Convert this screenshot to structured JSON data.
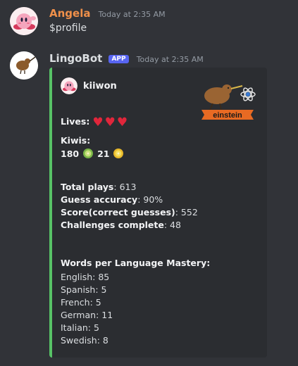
{
  "messages": [
    {
      "username": "Angela",
      "username_color": "#f0904a",
      "timestamp": "Today at 2:35 AM",
      "text": "$profile"
    },
    {
      "username": "LingoBot",
      "username_color": "#f2f3f5",
      "badge": "APP",
      "timestamp": "Today at 2:35 AM"
    }
  ],
  "embed": {
    "accent_color": "#57c266",
    "author": "kiiwon",
    "thumbnail_banner": "einstein",
    "lives_label": "Lives",
    "lives_count": 3,
    "kiwis_label": "Kiwis:",
    "kiwis_green": "180",
    "kiwis_gold": "21",
    "stats": [
      {
        "label": "Total plays",
        "value": "613"
      },
      {
        "label": "Guess accuracy",
        "value": "90%"
      },
      {
        "label": "Score(correct guesses)",
        "value": "552"
      },
      {
        "label": "Challenges complete",
        "value": "48"
      }
    ],
    "mastery_title": "Words per Language Mastery:",
    "languages": [
      {
        "name": "English",
        "value": "85"
      },
      {
        "name": "Spanish",
        "value": "5"
      },
      {
        "name": "French",
        "value": "5"
      },
      {
        "name": "German",
        "value": "11"
      },
      {
        "name": "Italian",
        "value": "5"
      },
      {
        "name": "Swedish",
        "value": "8"
      }
    ]
  }
}
